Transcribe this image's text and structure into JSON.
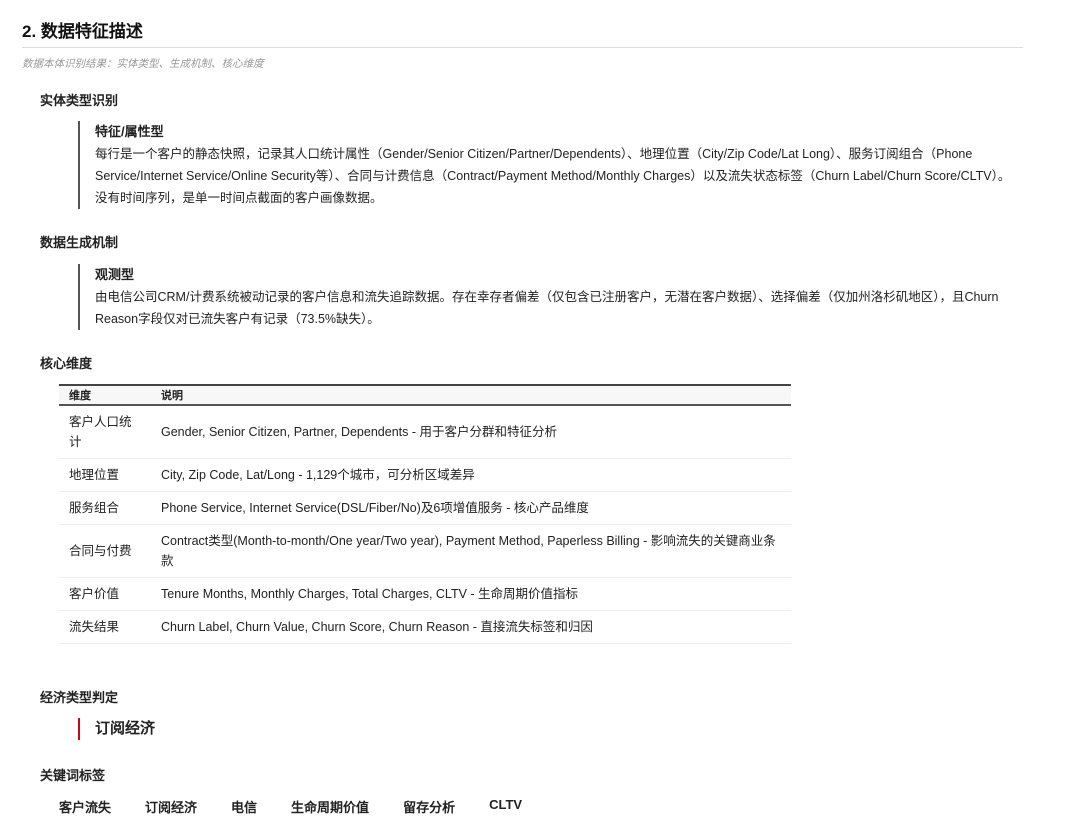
{
  "title": "2. 数据特征描述",
  "subtitle": "数据本体识别结果：实体类型、生成机制、核心维度",
  "entity": {
    "heading": "实体类型识别",
    "type": "特征/属性型",
    "description": "每行是一个客户的静态快照，记录其人口统计属性（Gender/Senior Citizen/Partner/Dependents）、地理位置（City/Zip Code/Lat Long）、服务订阅组合（Phone Service/Internet Service/Online Security等）、合同与计费信息（Contract/Payment Method/Monthly Charges）以及流失状态标签（Churn Label/Churn Score/CLTV）。没有时间序列，是单一时间点截面的客户画像数据。"
  },
  "generation": {
    "heading": "数据生成机制",
    "type": "观测型",
    "description": "由电信公司CRM/计费系统被动记录的客户信息和流失追踪数据。存在幸存者偏差（仅包含已注册客户，无潜在客户数据）、选择偏差（仅加州洛杉矶地区），且Churn Reason字段仅对已流失客户有记录（73.5%缺失）。"
  },
  "dimensions": {
    "heading": "核心维度",
    "columns": [
      "维度",
      "说明"
    ],
    "rows": [
      [
        "客户人口统计",
        "Gender, Senior Citizen, Partner, Dependents - 用于客户分群和特征分析"
      ],
      [
        "地理位置",
        "City, Zip Code, Lat/Long - 1,129个城市，可分析区域差异"
      ],
      [
        "服务组合",
        "Phone Service, Internet Service(DSL/Fiber/No)及6项增值服务 - 核心产品维度"
      ],
      [
        "合同与付费",
        "Contract类型(Month-to-month/One year/Two year), Payment Method, Paperless Billing - 影响流失的关键商业条款"
      ],
      [
        "客户价值",
        "Tenure Months, Monthly Charges, Total Charges, CLTV - 生命周期价值指标"
      ],
      [
        "流失结果",
        "Churn Label, Churn Value, Churn Score, Churn Reason - 直接流失标签和归因"
      ]
    ]
  },
  "economy": {
    "heading": "经济类型判定",
    "value": "订阅经济",
    "accent": "#d0021b"
  },
  "keywords": {
    "heading": "关键词标签",
    "tags": [
      "客户流失",
      "订阅经济",
      "电信",
      "生命周期价值",
      "留存分析",
      "CLTV"
    ]
  }
}
